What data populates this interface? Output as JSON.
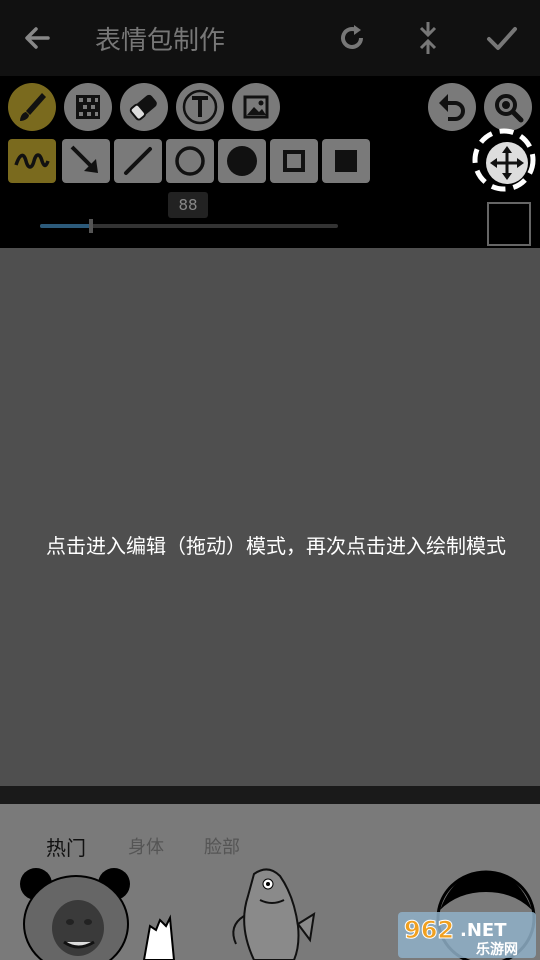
{
  "header": {
    "title": "表情包制作",
    "icons": [
      "back-arrow-icon",
      "refresh-icon",
      "compress-icon",
      "check-icon"
    ]
  },
  "tools": {
    "row1": [
      "brush-icon",
      "mosaic-icon",
      "eraser-icon",
      "text-icon",
      "image-icon"
    ],
    "row1_right": [
      "undo-icon",
      "zoom-icon"
    ],
    "row2": [
      "freehand-icon",
      "arrow-icon",
      "line-icon",
      "circle-outline-icon",
      "circle-filled-icon",
      "rect-outline-icon",
      "rect-filled-icon"
    ],
    "move": "move-icon"
  },
  "brush": {
    "size": "88",
    "size_fraction": 0.17
  },
  "canvas": {
    "hint": "点击进入编辑（拖动）模式，再次点击进入绘制模式"
  },
  "categories": {
    "tabs": [
      {
        "label": "热门",
        "active": true
      },
      {
        "label": "身体",
        "active": false
      },
      {
        "label": "脸部",
        "active": false
      }
    ]
  },
  "watermark": {
    "number": "962",
    "suffix": ".NET",
    "sub": "乐游网"
  },
  "colors": {
    "active_tool": "#7a6a1e",
    "canvas_bg": "#4f4f4f",
    "brush_color": "#000000"
  }
}
